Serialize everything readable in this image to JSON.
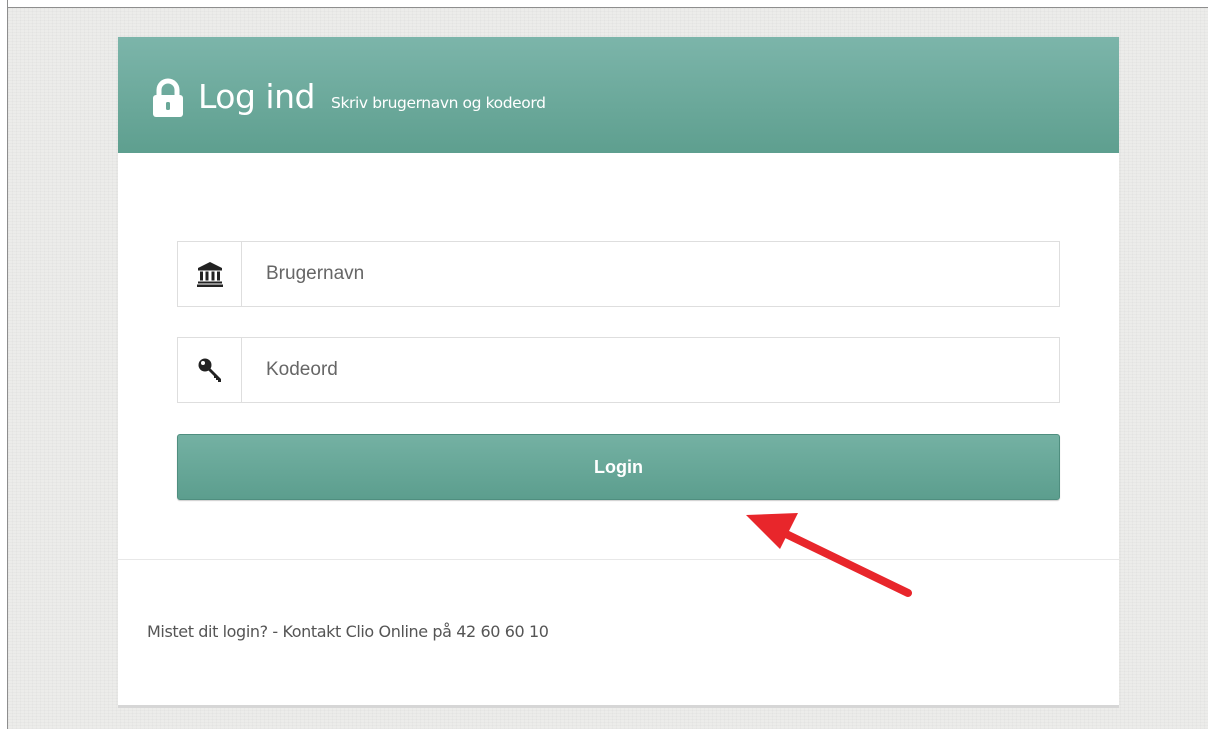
{
  "header": {
    "title": "Log ind",
    "subtitle": "Skriv brugernavn og kodeord",
    "icon": "lock-icon"
  },
  "form": {
    "username": {
      "placeholder": "Brugernavn",
      "value": "",
      "icon": "institution-icon"
    },
    "password": {
      "placeholder": "Kodeord",
      "value": "",
      "icon": "key-icon"
    },
    "login_label": "Login"
  },
  "footer": {
    "help_text": "Mistet dit login? - Kontakt Clio Online på 42 60 60 10"
  },
  "colors": {
    "brand": "#5e9f8f",
    "brand_light": "#7cb5aa",
    "annotation_arrow": "#e8262b",
    "background": "#ececea"
  }
}
